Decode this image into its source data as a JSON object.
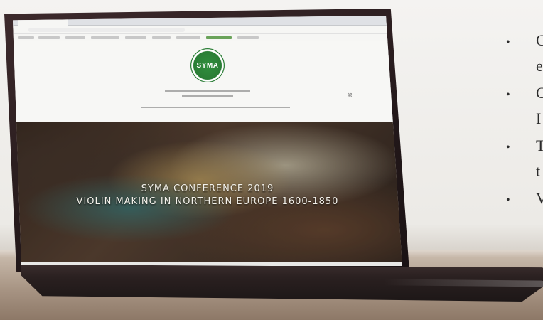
{
  "scene": {
    "browser_tab_label": "",
    "hero": {
      "title_line_1": "SYMA CONFERENCE 2019",
      "title_line_2": "VIOLIN MAKING IN NORTHERN EUROPE 1600-1850"
    },
    "logo": {
      "text": "SYMA"
    },
    "side_list": {
      "bullet_char": "•",
      "items": [
        "C",
        "e",
        "C",
        "I",
        "T",
        "t",
        "V"
      ]
    }
  },
  "colors": {
    "logo_green": "#2a7d35",
    "laptop_body": "#2a2020",
    "background": "#f4f3f1",
    "desk": "#a89584"
  }
}
